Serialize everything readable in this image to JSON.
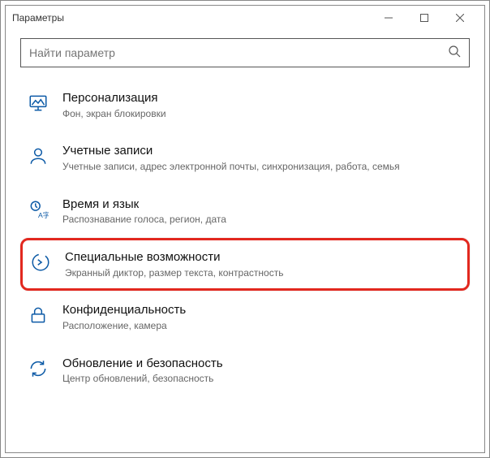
{
  "window": {
    "title": "Параметры"
  },
  "search": {
    "placeholder": "Найти параметр"
  },
  "items": [
    {
      "title": "Персонализация",
      "sub": "Фон, экран блокировки"
    },
    {
      "title": "Учетные записи",
      "sub": "Учетные записи, адрес электронной почты, синхронизация, работа, семья"
    },
    {
      "title": "Время и язык",
      "sub": "Распознавание голоса, регион, дата"
    },
    {
      "title": "Специальные возможности",
      "sub": "Экранный диктор, размер текста, контрастность"
    },
    {
      "title": "Конфиденциальность",
      "sub": "Расположение, камера"
    },
    {
      "title": "Обновление и безопасность",
      "sub": "Центр обновлений, безопасность"
    }
  ]
}
